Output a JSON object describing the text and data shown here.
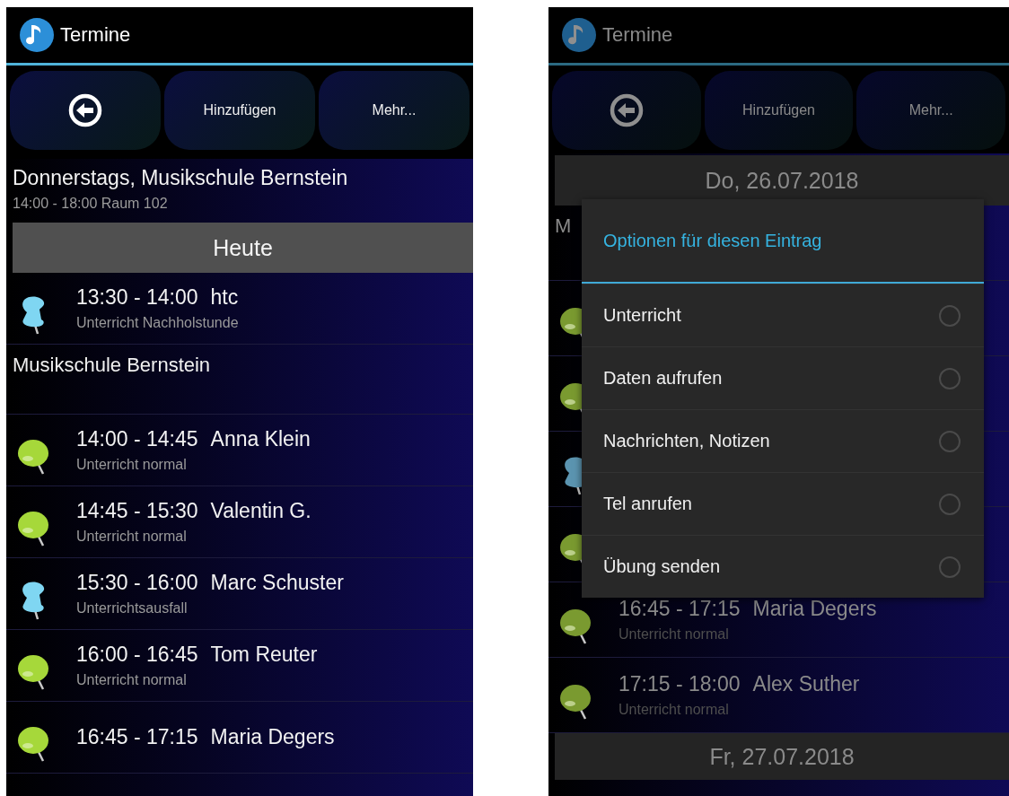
{
  "left_screen": {
    "app_title": "Termine",
    "toolbar": [
      {
        "kind": "back"
      },
      {
        "kind": "text",
        "label": "Hinzufügen"
      },
      {
        "kind": "text",
        "label": "Mehr..."
      }
    ],
    "location": {
      "title": "Donnerstags, Musikschule Bernstein",
      "subtitle": "14:00 - 18:00 Raum 102"
    },
    "day_header": "Heute",
    "entries": [
      {
        "kind": "tack",
        "color": "#7fd6f2",
        "time": "13:30 - 14:00",
        "name": "htc",
        "note": "Unterricht Nachholstunde"
      },
      {
        "kind": "group",
        "name": "Musikschule Bernstein"
      },
      {
        "kind": "ball",
        "color": "#a6d83a",
        "time": "14:00 - 14:45",
        "name": "Anna Klein",
        "note": "Unterricht normal"
      },
      {
        "kind": "ball",
        "color": "#a6d83a",
        "time": "14:45 - 15:30",
        "name": "Valentin G.",
        "note": "Unterricht normal"
      },
      {
        "kind": "tack",
        "color": "#7fd6f2",
        "time": "15:30 - 16:00",
        "name": "Marc Schuster",
        "note": "Unterrichtsausfall"
      },
      {
        "kind": "ball",
        "color": "#a6d83a",
        "time": "16:00 - 16:45",
        "name": "Tom Reuter",
        "note": "Unterricht normal"
      },
      {
        "kind": "ball",
        "color": "#a6d83a",
        "time": "16:45 - 17:15",
        "name": "Maria Degers"
      }
    ]
  },
  "right_screen": {
    "app_title": "Termine",
    "toolbar": [
      {
        "kind": "back"
      },
      {
        "kind": "text",
        "label": "Hinzufügen"
      },
      {
        "kind": "text",
        "label": "Mehr..."
      }
    ],
    "day_header": "Do, 26.07.2018",
    "entries": [
      {
        "kind": "group",
        "name": "M"
      },
      {
        "kind": "ball",
        "color": "#7a9a30"
      },
      {
        "kind": "ball",
        "color": "#7a9a30"
      },
      {
        "kind": "tack",
        "color": "#5b94b0"
      },
      {
        "kind": "ball",
        "color": "#7a9a30"
      },
      {
        "kind": "ball",
        "color": "#7a9a30",
        "time": "16:45 - 17:15",
        "name": "Maria Degers",
        "note": "Unterricht normal"
      },
      {
        "kind": "ball",
        "color": "#7a9a30",
        "time": "17:15 - 18:00",
        "name": "Alex Suther",
        "note": "Unterricht normal"
      }
    ],
    "next_day_header": "Fr, 27.07.2018",
    "dialog": {
      "title": "Optionen für diesen Eintrag",
      "options": [
        {
          "label": "Unterricht",
          "selected": false
        },
        {
          "label": "Daten aufrufen",
          "selected": false
        },
        {
          "label": "Nachrichten, Notizen",
          "selected": false
        },
        {
          "label": "Tel anrufen",
          "selected": false
        },
        {
          "label": "Übung senden",
          "selected": false
        }
      ]
    }
  }
}
